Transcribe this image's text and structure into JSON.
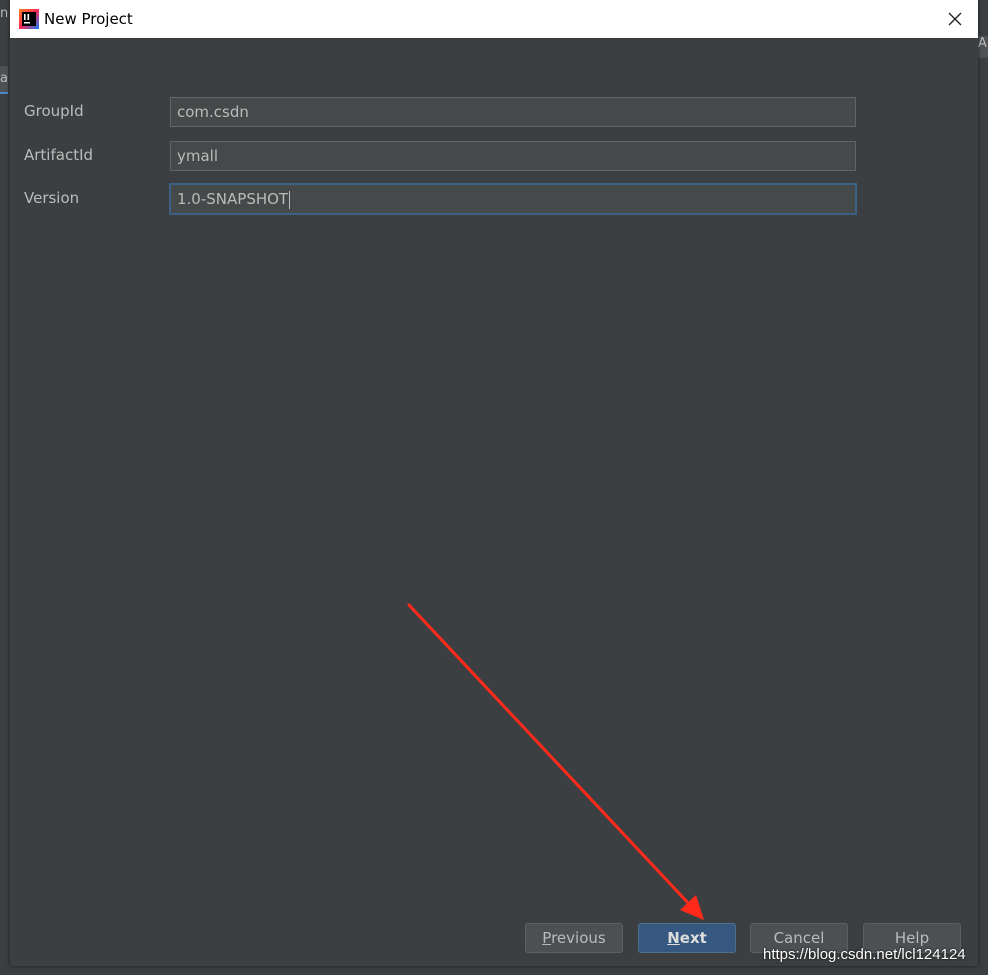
{
  "background": {
    "left_title_fragment": "n",
    "left_tab_fragment": "a",
    "right_tab_fragment": "A"
  },
  "dialog": {
    "title": "New Project",
    "app_icon": "intellij-idea-icon",
    "close_icon": "close-icon"
  },
  "form": {
    "group_id": {
      "label": "GroupId",
      "value": "com.csdn"
    },
    "artifact_id": {
      "label": "ArtifactId",
      "value": "ymall"
    },
    "version": {
      "label": "Version",
      "value": "1.0-SNAPSHOT"
    }
  },
  "buttons": {
    "previous": {
      "mnemonic": "P",
      "rest": "revious"
    },
    "next": {
      "mnemonic": "N",
      "rest": "ext"
    },
    "cancel": "Cancel",
    "help": "Help"
  },
  "annotation": {
    "arrow_color": "#ff2a1a"
  },
  "watermark": "https://blog.csdn.net/lcl124124",
  "colors": {
    "dialog_bg": "#3c3f41",
    "field_bg": "#45494a",
    "focus_border": "#3d6185",
    "default_button": "#365880",
    "text": "#bbbbbb"
  }
}
